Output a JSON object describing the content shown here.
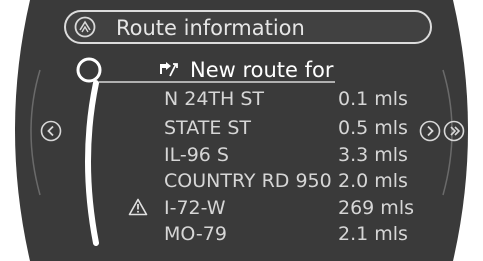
{
  "title": {
    "icon": "route-info-icon",
    "label": "Route information"
  },
  "header": {
    "icon": "new-route-icon",
    "label": "New route for"
  },
  "routes": [
    {
      "street": "N 24TH ST",
      "distance": "0.1 mls",
      "warning": false
    },
    {
      "street": "STATE ST",
      "distance": "0.5 mls",
      "warning": false
    },
    {
      "street": "IL-96 S",
      "distance": "3.3 mls",
      "warning": false
    },
    {
      "street": "COUNTRY RD 950",
      "distance": "2.0 mls",
      "warning": false
    },
    {
      "street": "I-72-W",
      "distance": "269 mls",
      "warning": true
    },
    {
      "street": "MO-79",
      "distance": "2.1 mls",
      "warning": false
    }
  ],
  "navigation": {
    "left_icon": "chevron-left-icon",
    "right_icon": "chevron-right-icon",
    "right_end_icon": "chevron-right-end-icon"
  },
  "colors": {
    "background": "#3a3a3a",
    "text": "#d6d6d6",
    "highlight": "#ffffff",
    "border": "#dcdcdc"
  }
}
